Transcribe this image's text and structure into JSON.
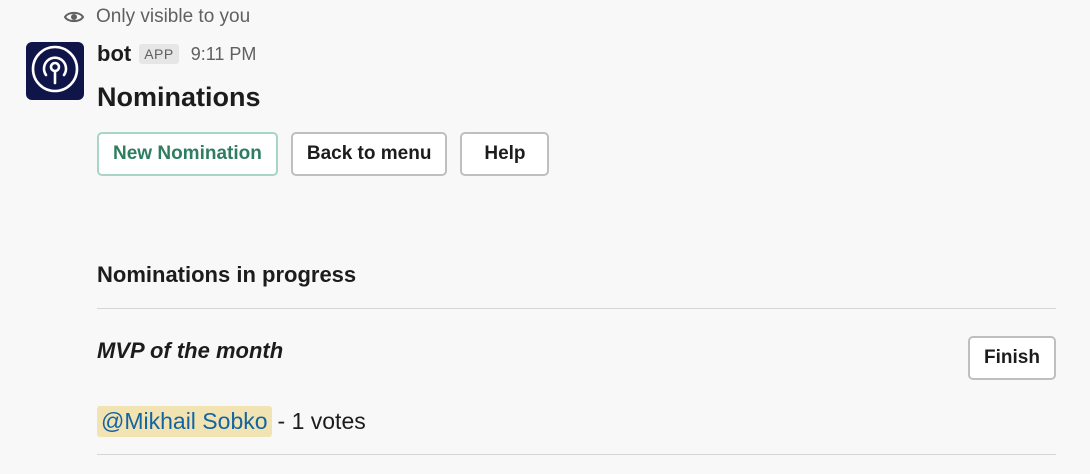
{
  "visibility": {
    "text": "Only visible to you",
    "icon": "eye-icon"
  },
  "message": {
    "author": "bot",
    "badge": "APP",
    "time": "9:11 PM",
    "avatar_icon": "broadcast-icon",
    "avatar_color": "#0f1548"
  },
  "title": "Nominations",
  "actions": {
    "new_nomination": "New Nomination",
    "back_to_menu": "Back to menu",
    "help": "Help"
  },
  "section": {
    "heading": "Nominations in progress"
  },
  "nominations": [
    {
      "name": "MVP of the month",
      "finish_label": "Finish",
      "votes": [
        {
          "mention": "@Mikhail Sobko",
          "text": "- 1 votes"
        }
      ]
    }
  ],
  "colors": {
    "background": "#f8f8f8",
    "primary_button_text": "#2f7d61",
    "mention_bg": "#f2e3b3",
    "mention_text": "#1264a3"
  }
}
